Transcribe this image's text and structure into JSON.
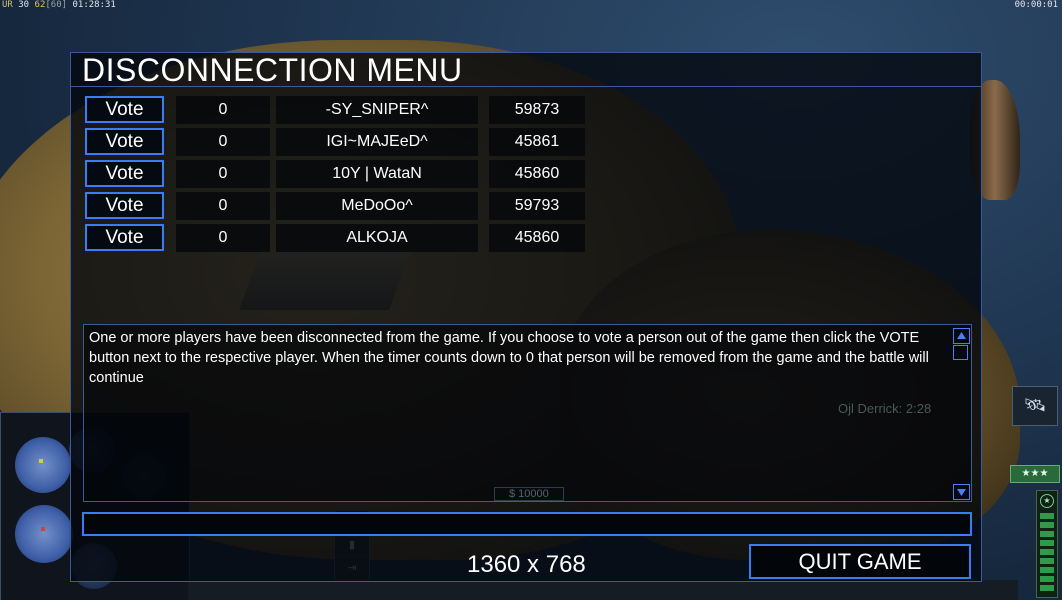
{
  "hud": {
    "top_left_prefix": "UR",
    "top_left_a": "30",
    "top_left_b": "62",
    "top_left_c": "[60]",
    "top_left_time": "01:28:31",
    "top_right_time": "00:00:01"
  },
  "dialog": {
    "title": "DISCONNECTION MENU",
    "players": [
      {
        "vote_label": "Vote",
        "count": "0",
        "name": "-SY_SNIPER^",
        "ping": "59873"
      },
      {
        "vote_label": "Vote",
        "count": "0",
        "name": "IGI~MAJEeD^",
        "ping": "45861"
      },
      {
        "vote_label": "Vote",
        "count": "0",
        "name": "10Y | WataN",
        "ping": "45860"
      },
      {
        "vote_label": "Vote",
        "count": "0",
        "name": "MeDoOo^",
        "ping": "59793"
      },
      {
        "vote_label": "Vote",
        "count": "0",
        "name": "ALKOJA",
        "ping": "45860"
      }
    ],
    "message": "One or more players have been disconnected from the game. If you choose to vote a person out of the game then click the VOTE button next to the respective player. When the timer counts down to 0 that person will be removed from the game and the battle will continue",
    "background_chat": "Ojl Derrick: 2:28",
    "background_money": "$ 10000",
    "chat_input": {
      "value": "",
      "placeholder": ""
    },
    "resolution": "1360 x 768",
    "quit_label": "QUIT GAME"
  },
  "side": {
    "stars": "★★★"
  },
  "colors": {
    "accent_blue": "#3a7df0",
    "dialog_border": "#3c5a9a",
    "text": "#ffffff"
  }
}
